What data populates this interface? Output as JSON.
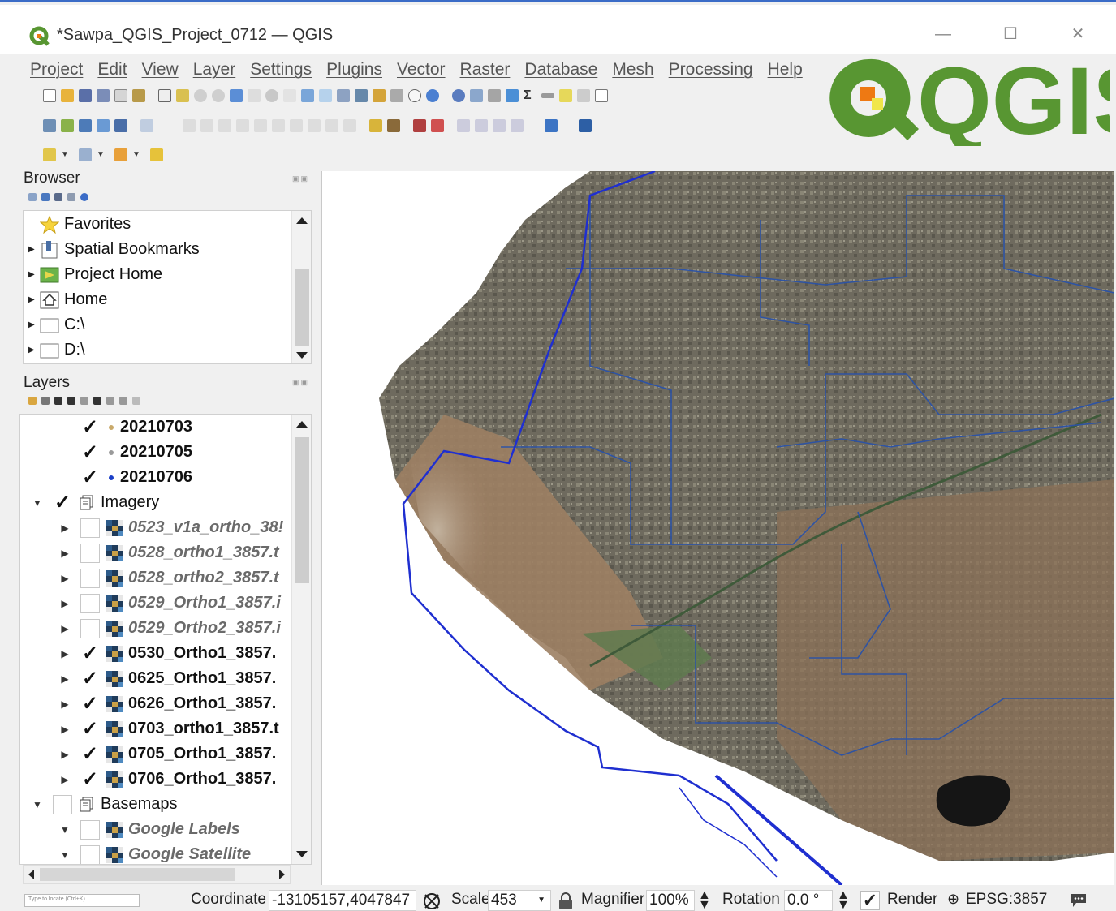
{
  "window": {
    "title": "*Sawpa_QGIS_Project_0712 — QGIS",
    "minimize": "—",
    "maximize": "☐",
    "close": "✕"
  },
  "menu": [
    "Project",
    "Edit",
    "View",
    "Layer",
    "Settings",
    "Plugins",
    "Vector",
    "Raster",
    "Database",
    "Mesh",
    "Processing",
    "Help"
  ],
  "brand": {
    "text": "QGIS",
    "colors": {
      "green": "#589632",
      "orange": "#ee7913",
      "yellow": "#f0e64a"
    }
  },
  "browser": {
    "title": "Browser",
    "items": [
      {
        "label": "Favorites",
        "icon": "star-icon",
        "expandable": false
      },
      {
        "label": "Spatial Bookmarks",
        "icon": "bookmark-icon",
        "expandable": true
      },
      {
        "label": "Project Home",
        "icon": "project-home-icon",
        "expandable": true
      },
      {
        "label": "Home",
        "icon": "home-icon",
        "expandable": true
      },
      {
        "label": "C:\\",
        "icon": "folder-icon",
        "expandable": true
      },
      {
        "label": "D:\\",
        "icon": "folder-icon",
        "expandable": true
      }
    ]
  },
  "layers": {
    "title": "Layers",
    "items": [
      {
        "label": "20210703",
        "style": "bold",
        "checked": true,
        "kind": "point",
        "dot_color": "#c9a96a",
        "indent": 2
      },
      {
        "label": "20210705",
        "style": "bold",
        "checked": true,
        "kind": "point",
        "dot_color": "#9a9a9a",
        "indent": 2
      },
      {
        "label": "20210706",
        "style": "bold",
        "checked": true,
        "kind": "point",
        "dot_color": "#1a3fc7",
        "indent": 2
      },
      {
        "label": "Imagery",
        "style": "plain",
        "checked": true,
        "kind": "group",
        "expanded": true,
        "indent": 0
      },
      {
        "label": "0523_v1a_ortho_38!",
        "style": "italic",
        "checked": false,
        "kind": "raster",
        "indent": 1
      },
      {
        "label": "0528_ortho1_3857.t",
        "style": "italic",
        "checked": false,
        "kind": "raster",
        "indent": 1
      },
      {
        "label": "0528_ortho2_3857.t",
        "style": "italic",
        "checked": false,
        "kind": "raster",
        "indent": 1
      },
      {
        "label": "0529_Ortho1_3857.i",
        "style": "italic",
        "checked": false,
        "kind": "raster",
        "indent": 1
      },
      {
        "label": "0529_Ortho2_3857.i",
        "style": "italic",
        "checked": false,
        "kind": "raster",
        "indent": 1
      },
      {
        "label": "0530_Ortho1_3857.",
        "style": "bold",
        "checked": true,
        "kind": "raster",
        "indent": 1
      },
      {
        "label": "0625_Ortho1_3857.",
        "style": "bold",
        "checked": true,
        "kind": "raster",
        "indent": 1
      },
      {
        "label": "0626_Ortho1_3857.",
        "style": "bold",
        "checked": true,
        "kind": "raster",
        "indent": 1
      },
      {
        "label": "0703_ortho1_3857.t",
        "style": "bold",
        "checked": true,
        "kind": "raster",
        "indent": 1
      },
      {
        "label": "0705_Ortho1_3857.",
        "style": "bold",
        "checked": true,
        "kind": "raster",
        "indent": 1
      },
      {
        "label": "0706_Ortho1_3857.",
        "style": "bold",
        "checked": true,
        "kind": "raster",
        "indent": 1
      },
      {
        "label": "Basemaps",
        "style": "plain",
        "checked": false,
        "kind": "group",
        "expanded": true,
        "indent": 0
      },
      {
        "label": "Google Labels",
        "style": "italic",
        "checked": false,
        "kind": "raster",
        "expanded": true,
        "indent": 1
      },
      {
        "label": "Google Satellite",
        "style": "italic",
        "checked": false,
        "kind": "raster",
        "expanded": true,
        "indent": 1
      }
    ]
  },
  "status": {
    "locator_placeholder": "Type to locate (Ctrl+K)",
    "coordinate_label": "Coordinate",
    "coordinate_value": "-13105157,4047847",
    "scale_label": "Scale",
    "scale_value": "453",
    "magnifier_label": "Magnifier",
    "magnifier_value": "100%",
    "rotation_label": "Rotation",
    "rotation_value": "0.0 °",
    "render_label": "Render",
    "render_checked": true,
    "crs": "EPSG:3857"
  }
}
